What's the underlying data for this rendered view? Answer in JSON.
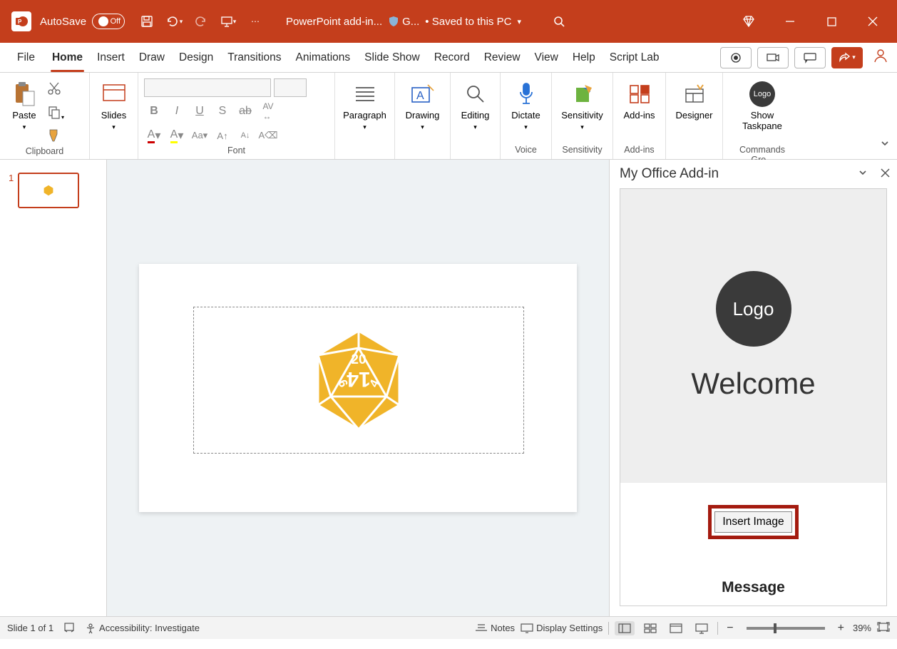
{
  "titlebar": {
    "autosave_label": "AutoSave",
    "autosave_state": "Off",
    "doc_title_truncated": "PowerPoint add-in...",
    "shield_text": "G...",
    "saved_text": "• Saved to this PC"
  },
  "ribbon": {
    "tabs": [
      "File",
      "Home",
      "Insert",
      "Draw",
      "Design",
      "Transitions",
      "Animations",
      "Slide Show",
      "Record",
      "Review",
      "View",
      "Help",
      "Script Lab"
    ],
    "active_tab": "Home",
    "groups": {
      "clipboard": {
        "label": "Clipboard",
        "paste": "Paste"
      },
      "slides": {
        "label": "Slides",
        "slides_btn": "Slides"
      },
      "font": {
        "label": "Font"
      },
      "paragraph": {
        "label": "Paragraph"
      },
      "drawing": {
        "label": "Drawing"
      },
      "editing": {
        "label": "Editing"
      },
      "voice": {
        "label": "Voice",
        "dictate": "Dictate"
      },
      "sensitivity": {
        "label": "Sensitivity",
        "sensitivity_btn": "Sensitivity"
      },
      "addins": {
        "label": "Add-ins",
        "addins_btn": "Add-ins"
      },
      "designer": {
        "label": "Designer"
      },
      "commands": {
        "label": "Commands Gro...",
        "logo_text": "Logo",
        "show_tp_line1": "Show",
        "show_tp_line2": "Taskpane"
      }
    }
  },
  "thumbnails": {
    "slide1_number": "1"
  },
  "taskpane": {
    "title": "My Office Add-in",
    "logo_text": "Logo",
    "welcome": "Welcome",
    "insert_btn": "Insert Image",
    "message_label": "Message"
  },
  "statusbar": {
    "slide_info": "Slide 1 of 1",
    "accessibility": "Accessibility: Investigate",
    "notes": "Notes",
    "display": "Display Settings",
    "zoom_pct": "39%"
  },
  "colors": {
    "brand": "#c43e1c",
    "dice": "#f0b429"
  }
}
